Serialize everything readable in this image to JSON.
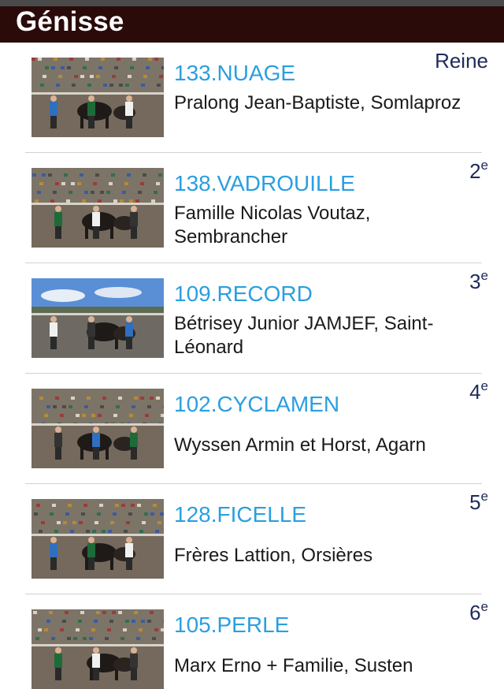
{
  "header": {
    "title": "Génisse"
  },
  "entries": [
    {
      "name": "133.NUAGE",
      "owner": "Pralong Jean-Baptiste, Somlaproz",
      "rank_main": "Reine",
      "rank_sup": "",
      "sky": false,
      "thumb_icon": "photo-cow-ring"
    },
    {
      "name": "138.VADROUILLE",
      "owner": "Famille Nicolas Voutaz, Sembrancher",
      "rank_main": "2",
      "rank_sup": "e",
      "sky": false,
      "thumb_icon": "photo-cow-ring"
    },
    {
      "name": "109.RECORD",
      "owner": "Bétrisey Junior JAMJEF, Saint-Léonard",
      "rank_main": "3",
      "rank_sup": "e",
      "sky": true,
      "thumb_icon": "photo-cow-ring"
    },
    {
      "name": "102.CYCLAMEN",
      "owner": "Wyssen Armin et Horst, Agarn",
      "rank_main": "4",
      "rank_sup": "e",
      "sky": false,
      "thumb_icon": "photo-cow-ring"
    },
    {
      "name": "128.FICELLE",
      "owner": "Frères Lattion, Orsières",
      "rank_main": "5",
      "rank_sup": "e",
      "sky": false,
      "thumb_icon": "photo-cow-ring"
    },
    {
      "name": "105.PERLE",
      "owner": "Marx Erno + Familie, Susten",
      "rank_main": "6",
      "rank_sup": "e",
      "sky": false,
      "thumb_icon": "photo-cow-ring"
    }
  ],
  "colors": {
    "header_bg": "#2b0a0a",
    "name": "#2a9fe0",
    "rank": "#1f2a5a",
    "divider": "#d2d2d2"
  }
}
